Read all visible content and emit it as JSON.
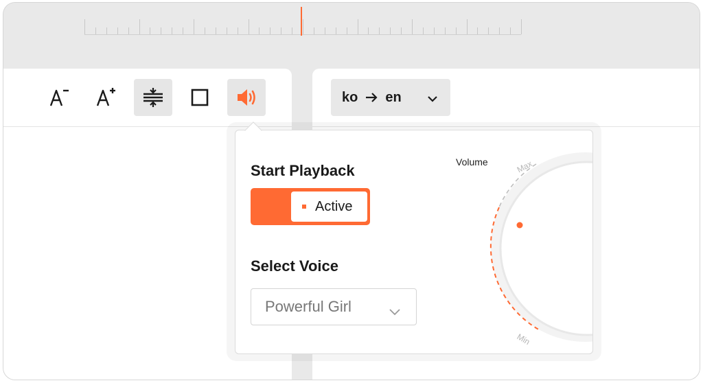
{
  "ruler": {
    "accent": "#ff6a33"
  },
  "toolbar": {
    "buttons": [
      {
        "name": "decrease-font-button",
        "icon": "font-decrease-icon",
        "active": false
      },
      {
        "name": "increase-font-button",
        "icon": "font-increase-icon",
        "active": false
      },
      {
        "name": "line-spacing-button",
        "icon": "line-spacing-icon",
        "active": true
      },
      {
        "name": "box-button",
        "icon": "square-icon",
        "active": false
      },
      {
        "name": "speaker-button",
        "icon": "speaker-icon",
        "active": true
      }
    ]
  },
  "language": {
    "source": "ko",
    "target": "en"
  },
  "playback": {
    "title": "Start Playback",
    "toggle_label": "Active",
    "toggle_on": true
  },
  "voice": {
    "title": "Select Voice",
    "selected": "Powerful Girl"
  },
  "volume": {
    "label": "Volume",
    "max_label": "Max",
    "min_label": "Min"
  },
  "colors": {
    "accent": "#ff6a33",
    "toolbar_active": "#e6e6e6"
  }
}
